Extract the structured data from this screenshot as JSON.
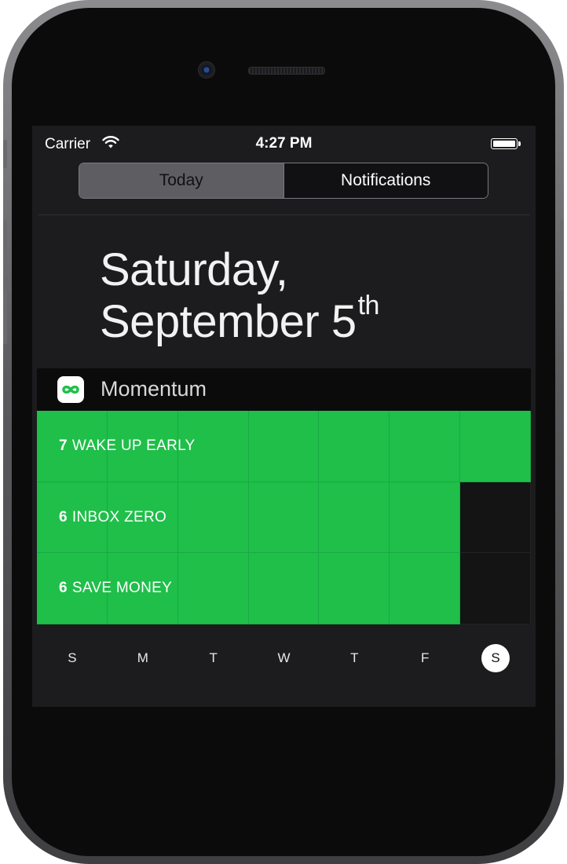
{
  "status_bar": {
    "carrier": "Carrier",
    "time": "4:27 PM"
  },
  "tabs": {
    "today": "Today",
    "notifications": "Notifications"
  },
  "date": {
    "weekday_line": "Saturday,",
    "month_line": "September 5",
    "ordinal_suffix": "th"
  },
  "widget": {
    "title": "Momentum",
    "icon": "infinity-icon",
    "accent_color": "#1fbf4a",
    "habits": [
      {
        "count": "7",
        "name": "WAKE UP EARLY",
        "completed_days": [
          true,
          true,
          true,
          true,
          true,
          true,
          true
        ]
      },
      {
        "count": "6",
        "name": "INBOX ZERO",
        "completed_days": [
          true,
          true,
          true,
          true,
          true,
          true,
          false
        ]
      },
      {
        "count": "6",
        "name": "SAVE MONEY",
        "completed_days": [
          true,
          true,
          true,
          true,
          true,
          true,
          false
        ]
      }
    ],
    "days": [
      "S",
      "M",
      "T",
      "W",
      "T",
      "F",
      "S"
    ],
    "current_day_index": 6
  }
}
